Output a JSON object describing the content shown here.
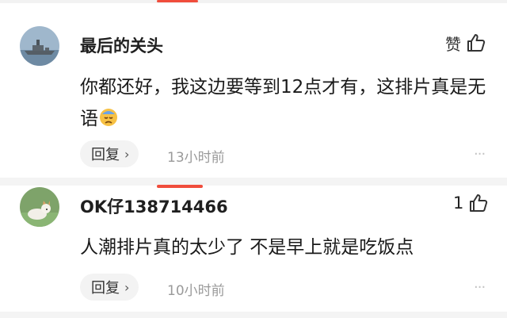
{
  "comments": [
    {
      "username": "最后的关头",
      "like_label": "赞",
      "content_line1": "你都还好，我这边要等到12点才有，这排片真是无",
      "content_line2": "语",
      "emoji": "pensive-face",
      "reply_label": "回复",
      "time": "13小时前",
      "avatar": "warship-avatar"
    },
    {
      "username": "OK仔138714466",
      "like_count": "1",
      "content_line1": "人潮排片真的太少了 不是早上就是吃饭点",
      "reply_label": "回复",
      "time": "10小时前",
      "avatar": "dog-avatar"
    }
  ],
  "more_glyph": "···",
  "reply_chevron": "›",
  "colors": {
    "accent": "#f04d3c",
    "divider": "#f4f4f4",
    "reply_bg": "#f3f3f3",
    "muted": "#9a9a9a"
  }
}
